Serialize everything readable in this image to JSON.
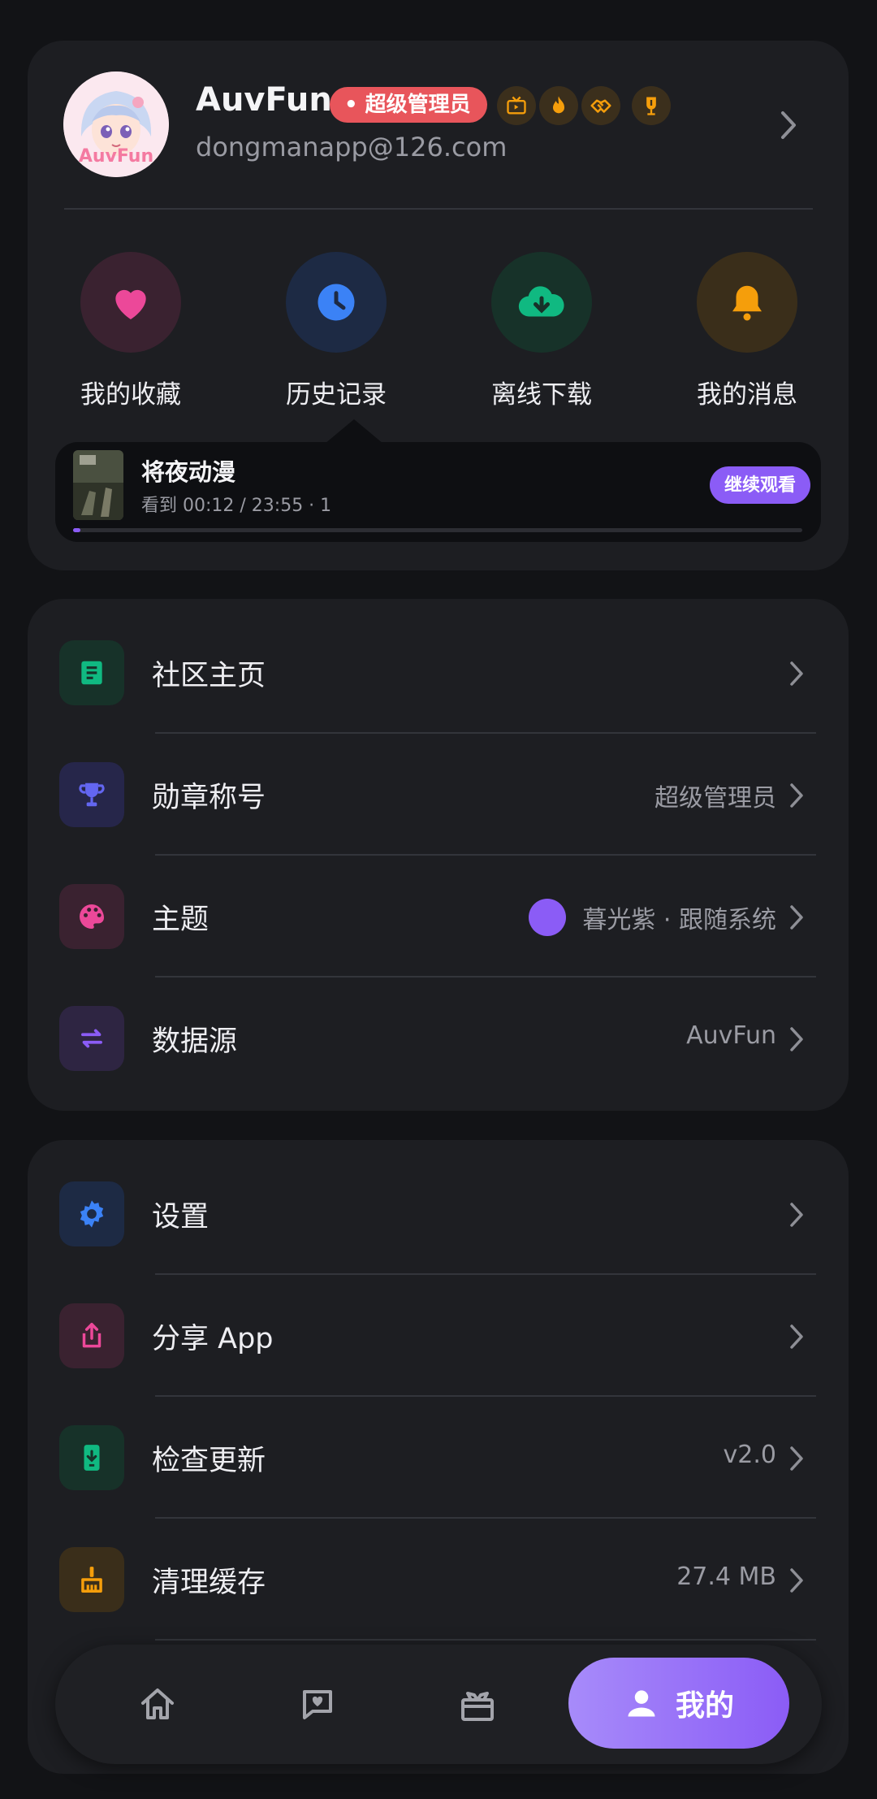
{
  "profile": {
    "avatar_text": "AuvFun",
    "username": "AuvFun",
    "role_badge": "超级管理员",
    "email": "dongmanapp@126.com",
    "medals": [
      "tv-medal-icon",
      "fire-medal-icon",
      "handshake-medal-icon",
      "award-medal-icon"
    ]
  },
  "quick_actions": [
    {
      "label": "我的收藏",
      "icon": "heart-icon",
      "color": "#ec4899",
      "bg": "#3a2230"
    },
    {
      "label": "历史记录",
      "icon": "clock-icon",
      "color": "#3b82f6",
      "bg": "#1d2a44"
    },
    {
      "label": "离线下载",
      "icon": "cloud-download-icon",
      "color": "#10b981",
      "bg": "#173229"
    },
    {
      "label": "我的消息",
      "icon": "bell-icon",
      "color": "#f59e0b",
      "bg": "#3a2e1a"
    }
  ],
  "continue_watching": {
    "title": "将夜动漫",
    "progress_text": "看到 00:12 / 23:55 · 1",
    "button": "继续观看",
    "progress_fraction": 0.01
  },
  "menu_group_1": [
    {
      "label": "社区主页",
      "value": "",
      "icon": "document-icon",
      "color": "#10b981",
      "bg": "#173229"
    },
    {
      "label": "勋章称号",
      "value": "超级管理员",
      "icon": "trophy-icon",
      "color": "#6366f1",
      "bg": "#26264a"
    },
    {
      "label": "主题",
      "value": "暮光紫 · 跟随系统",
      "icon": "palette-icon",
      "color": "#ec4899",
      "bg": "#3a2230"
    },
    {
      "label": "数据源",
      "value": "AuvFun",
      "icon": "swap-icon",
      "color": "#8b5cf6",
      "bg": "#2e2542"
    }
  ],
  "menu_group_2": [
    {
      "label": "设置",
      "value": "",
      "icon": "gear-icon",
      "color": "#3b82f6",
      "bg": "#1d2a44"
    },
    {
      "label": "分享 App",
      "value": "",
      "icon": "share-icon",
      "color": "#ec4899",
      "bg": "#3a2230"
    },
    {
      "label": "检查更新",
      "value": "v2.0",
      "icon": "phone-download-icon",
      "color": "#10b981",
      "bg": "#173229"
    },
    {
      "label": "清理缓存",
      "value": "27.4 MB",
      "icon": "broom-icon",
      "color": "#f59e0b",
      "bg": "#3a2e1a"
    }
  ],
  "bottom_nav": {
    "items": [
      "home-icon",
      "chat-heart-icon",
      "gift-icon"
    ],
    "active_label": "我的",
    "active_icon": "user-icon"
  },
  "colors": {
    "accent": "#8b5cf6",
    "badge": "#e8555b",
    "card": "#1d1e22",
    "background": "#121316"
  }
}
